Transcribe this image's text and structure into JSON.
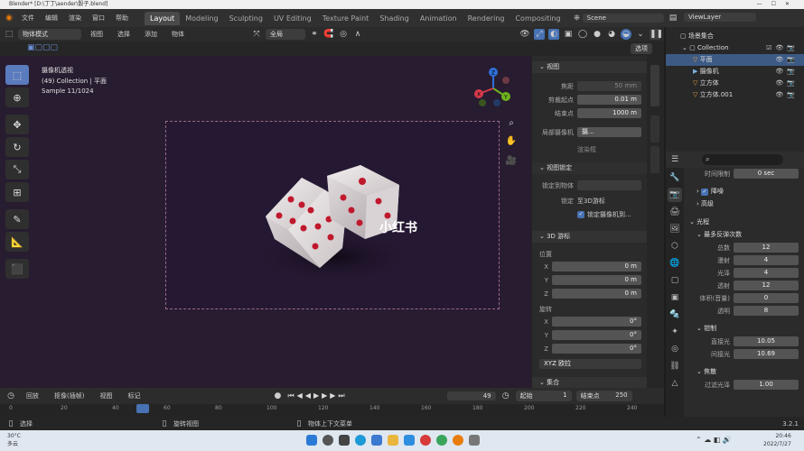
{
  "titlebar": {
    "text": "Blender* [D:\\丁丁\\aender\\骰子.blend]"
  },
  "menus": [
    "文件",
    "编辑",
    "渲染",
    "窗口",
    "帮助"
  ],
  "workspaces": [
    "Layout",
    "Modeling",
    "Sculpting",
    "UV Editing",
    "Texture Paint",
    "Shading",
    "Animation",
    "Rendering",
    "Compositing"
  ],
  "active_workspace": "Layout",
  "scene": "Scene",
  "view_layer": "ViewLayer",
  "viewport_header": {
    "mode": "物体模式",
    "menus": [
      "视图",
      "选择",
      "添加",
      "物体"
    ],
    "transform": "全局",
    "options": "选项"
  },
  "overlay": {
    "line1": "摄像机透视",
    "line2": "(49) Collection | 平面",
    "line3": "Sample 11/1024"
  },
  "watermark": "小红书",
  "npanel": {
    "view_section": "视图",
    "focal_label": "焦距",
    "focal_value": "50 mm",
    "clip_start_label": "剪裁起点",
    "clip_start_value": "0.01 m",
    "clip_end_label": "结束点",
    "clip_end_value": "1000 m",
    "local_camera_label": "局部摄像机",
    "local_camera_value": "摄...",
    "render_region": "渲染框",
    "view_lock_section": "视图锁定",
    "lock_to_object_label": "锁定到物体",
    "lock_label": "锁定",
    "lock_3d_cursor": "至3D游标",
    "lock_camera": "锁定摄像机到...",
    "cursor_section": "3D 游标",
    "location_label": "位置",
    "x": "X",
    "y": "Y",
    "z": "Z",
    "loc_x": "0 m",
    "loc_y": "0 m",
    "loc_z": "0 m",
    "rotation_label": "旋转",
    "rot_x": "0°",
    "rot_y": "0°",
    "rot_z": "0°",
    "rotation_mode": "XYZ 欧拉",
    "last_section": "集合"
  },
  "outliner": {
    "root": "场景集合",
    "collection": "Collection",
    "items": [
      "平面",
      "摄像机",
      "立方体",
      "立方体.001"
    ]
  },
  "properties": {
    "time_limit_label": "时间限制",
    "time_limit_value": "0 sec",
    "denoise": "降噪",
    "advanced": "高级",
    "light_paths": "光程",
    "max_bounces": "最多反弹次数",
    "rows": [
      {
        "label": "总数",
        "value": "12"
      },
      {
        "label": "漫射",
        "value": "4"
      },
      {
        "label": "光泽",
        "value": "4"
      },
      {
        "label": "透射",
        "value": "12"
      },
      {
        "label": "体积(音量)",
        "value": "0"
      },
      {
        "label": "透明",
        "value": "8"
      }
    ],
    "clamping": "钳制",
    "direct_label": "直接光",
    "direct_value": "10.05",
    "indirect_label": "间接光",
    "indirect_value": "10.69",
    "caustics": "焦散",
    "blur_label": "过滤光泽",
    "blur_value": "1.00"
  },
  "timeline": {
    "menus": [
      "回放",
      "抠像(插帧)",
      "视图",
      "标记"
    ],
    "current_frame": "49",
    "start_label": "起始",
    "start_value": "1",
    "end_label": "结束点",
    "end_value": "250"
  },
  "ruler_ticks": [
    "0",
    "20",
    "40",
    "60",
    "80",
    "100",
    "120",
    "140",
    "160",
    "180",
    "200",
    "220",
    "240"
  ],
  "statusbar": {
    "select": "选择",
    "rotate": "旋转视图",
    "context": "物体上下文菜单",
    "version": "3.2.1"
  },
  "taskbar": {
    "temp": "30°C",
    "weather": "多云",
    "time": "20:46",
    "date": "2022/7/27"
  },
  "colors": {
    "accent": "#4772b3",
    "viewport_bg": "#271c30",
    "selected_row": "#3d5a85"
  }
}
